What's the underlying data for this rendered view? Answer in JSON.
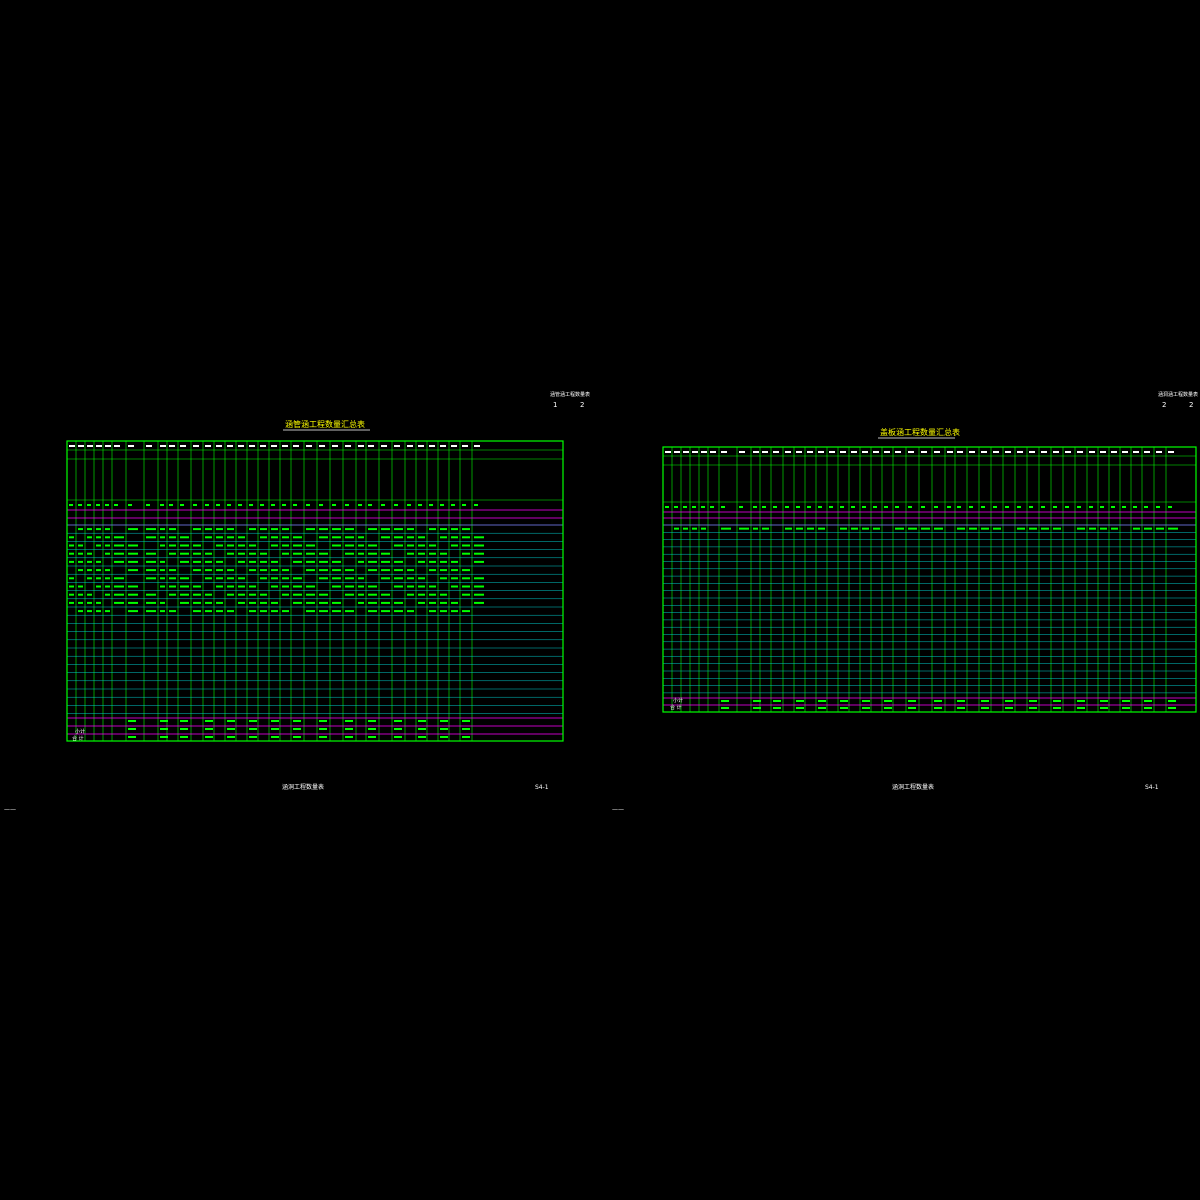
{
  "sheet1": {
    "corner_title": "涵管涵工程数量表",
    "corner_page": "1",
    "corner_pages": "2",
    "title": "涵管涵工程数量汇总表",
    "footer_title": "涵洞工程数量表",
    "footer_code": "S4-1",
    "total_label": "合 计",
    "subtotal_label": "小计"
  },
  "sheet2": {
    "corner_title": "涵洞涵工程数量表",
    "corner_page": "2",
    "corner_pages": "2",
    "title": "盖板涵工程数量汇总表",
    "footer_title": "涵洞工程数量表",
    "footer_code": "S4-1",
    "total_label": "合 计",
    "subtotal_label": "小计"
  },
  "left_marker": "——",
  "right_marker": "——",
  "colors": {
    "background": "#000000",
    "grid_green": "#00ff00",
    "grid_cyan": "#00cccc",
    "accent_magenta": "#ff00ff",
    "text_white": "#ffffff",
    "text_yellow": "#ffff00"
  }
}
